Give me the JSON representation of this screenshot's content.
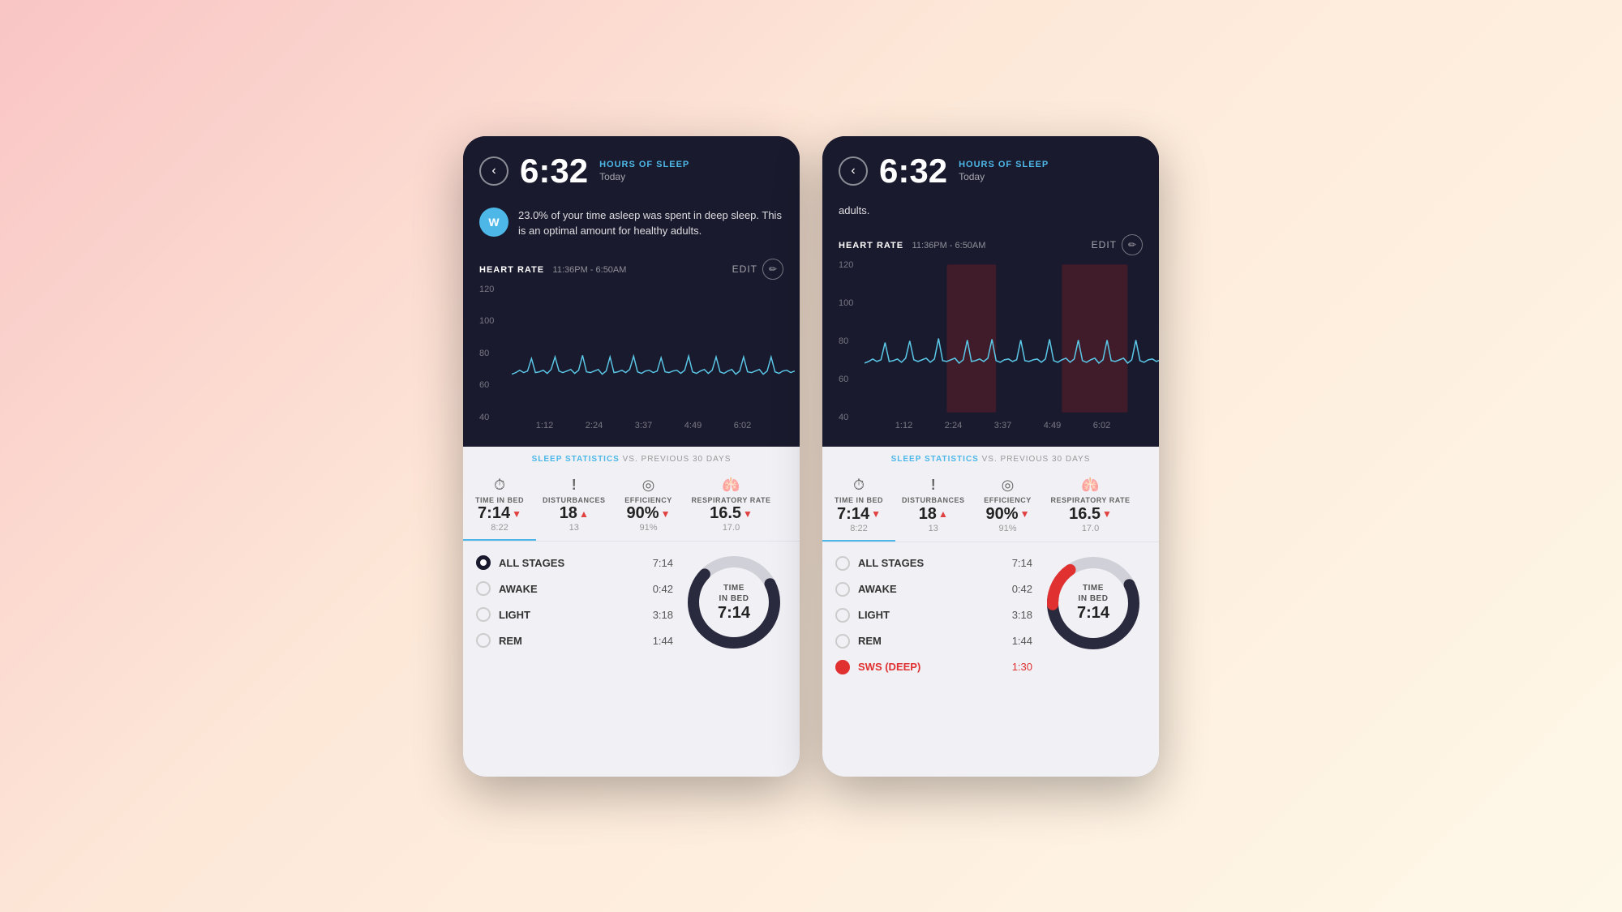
{
  "panels": [
    {
      "id": "left",
      "header": {
        "time": "6:32",
        "hours_label": "HOURS OF SLEEP",
        "day": "Today"
      },
      "info": {
        "avatar_initials": "W",
        "message": "23.0% of your time asleep was spent in deep sleep. This is an optimal amount for healthy adults."
      },
      "heart_rate": {
        "label": "HEART RATE",
        "time_range": "11:36PM - 6:50AM",
        "edit_label": "EDIT"
      },
      "chart": {
        "y_labels": [
          "120",
          "100",
          "80",
          "60",
          "40"
        ],
        "x_labels": [
          "1:12",
          "2:24",
          "3:37",
          "4:49",
          "6:02"
        ]
      },
      "sleep_stats": {
        "header": "SLEEP STATISTICS",
        "sub": "VS. PREVIOUS 30 DAYS",
        "tabs": [
          {
            "icon": "⏱",
            "label": "TIME IN BED",
            "value": "7:14",
            "trend": "down",
            "prev": "8:22",
            "active": true
          },
          {
            "icon": "!",
            "label": "DISTURBANCES",
            "value": "18",
            "trend": "up",
            "prev": "13",
            "active": false
          },
          {
            "icon": "◎",
            "label": "EFFICIENCY",
            "value": "90%",
            "trend": "down",
            "prev": "91%",
            "active": false
          },
          {
            "icon": "🫁",
            "label": "RESPIRATORY RATE",
            "value": "16.5",
            "trend": "down",
            "prev": "17.0",
            "active": false
          }
        ]
      },
      "stages": {
        "rows": [
          {
            "label": "ALL STAGES",
            "value": "7:14",
            "selected": true,
            "sws": false
          },
          {
            "label": "AWAKE",
            "value": "0:42",
            "selected": false,
            "sws": false
          },
          {
            "label": "LIGHT",
            "value": "3:18",
            "selected": false,
            "sws": false
          },
          {
            "label": "REM",
            "value": "1:44",
            "selected": false,
            "sws": false
          }
        ],
        "donut": {
          "label_title": "TIME\nIN BED",
          "label_value": "7:14"
        }
      }
    },
    {
      "id": "right",
      "header": {
        "time": "6:32",
        "hours_label": "HOURS OF SLEEP",
        "day": "Today"
      },
      "info": {
        "truncated_text": "adults."
      },
      "heart_rate": {
        "label": "HEART RATE",
        "time_range": "11:36PM - 6:50AM",
        "edit_label": "EDIT"
      },
      "chart": {
        "y_labels": [
          "120",
          "100",
          "80",
          "60",
          "40"
        ],
        "x_labels": [
          "1:12",
          "2:24",
          "3:37",
          "4:49",
          "6:02"
        ]
      },
      "sleep_stats": {
        "header": "SLEEP STATISTICS",
        "sub": "VS. PREVIOUS 30 DAYS",
        "tabs": [
          {
            "icon": "⏱",
            "label": "TIME IN BED",
            "value": "7:14",
            "trend": "down",
            "prev": "8:22",
            "active": true
          },
          {
            "icon": "!",
            "label": "DISTURBANCES",
            "value": "18",
            "trend": "up",
            "prev": "13",
            "active": false
          },
          {
            "icon": "◎",
            "label": "EFFICIENCY",
            "value": "90%",
            "trend": "down",
            "prev": "91%",
            "active": false
          },
          {
            "icon": "🫁",
            "label": "RESPIRATORY RATE",
            "value": "16.5",
            "trend": "down",
            "prev": "17.0",
            "active": false
          }
        ]
      },
      "stages": {
        "rows": [
          {
            "label": "ALL STAGES",
            "value": "7:14",
            "selected": false,
            "sws": false
          },
          {
            "label": "AWAKE",
            "value": "0:42",
            "selected": false,
            "sws": false
          },
          {
            "label": "LIGHT",
            "value": "3:18",
            "selected": false,
            "sws": false
          },
          {
            "label": "REM",
            "value": "1:44",
            "selected": false,
            "sws": false
          },
          {
            "label": "SWS (DEEP)",
            "value": "1:30",
            "selected": false,
            "sws": true
          }
        ],
        "donut": {
          "label_title": "TIME\nIN BED",
          "label_value": "7:14"
        }
      }
    }
  ],
  "back_icon": "‹",
  "edit_pencil": "✏"
}
